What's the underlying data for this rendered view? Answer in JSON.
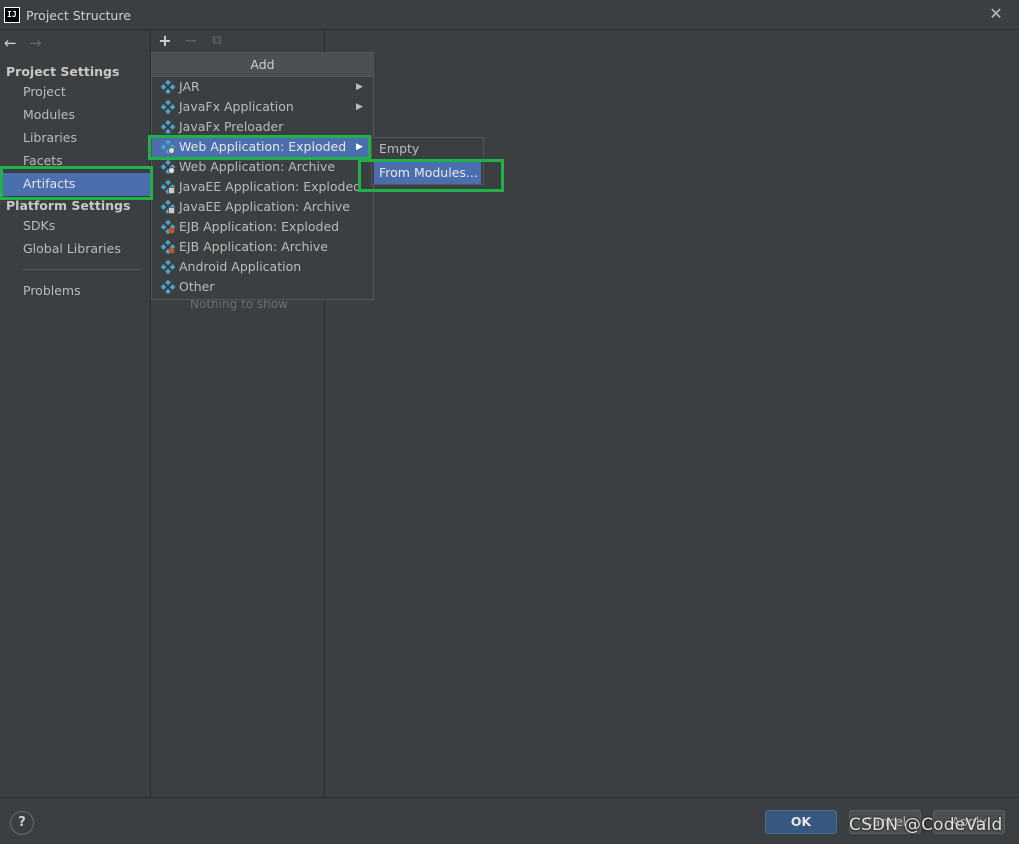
{
  "window": {
    "title": "Project Structure"
  },
  "sidebar": {
    "project_settings_header": "Project Settings",
    "project_items": [
      "Project",
      "Modules",
      "Libraries",
      "Facets",
      "Artifacts"
    ],
    "platform_settings_header": "Platform Settings",
    "platform_items": [
      "SDKs",
      "Global Libraries"
    ],
    "problems": "Problems",
    "selected": "Artifacts"
  },
  "artifacts": {
    "empty_text": "Nothing to show"
  },
  "add_menu": {
    "title": "Add",
    "items": [
      {
        "label": "JAR",
        "submenu": true
      },
      {
        "label": "JavaFx Application",
        "submenu": true
      },
      {
        "label": "JavaFx Preloader",
        "submenu": false
      },
      {
        "label": "Web Application: Exploded",
        "submenu": true
      },
      {
        "label": "Web Application: Archive",
        "submenu": false
      },
      {
        "label": "JavaEE Application: Exploded",
        "submenu": false
      },
      {
        "label": "JavaEE Application: Archive",
        "submenu": false
      },
      {
        "label": "EJB Application: Exploded",
        "submenu": false
      },
      {
        "label": "EJB Application: Archive",
        "submenu": false
      },
      {
        "label": "Android Application",
        "submenu": false
      },
      {
        "label": "Other",
        "submenu": false
      }
    ],
    "active_item": "Web Application: Exploded"
  },
  "submenu": {
    "items": [
      "Empty",
      "From Modules..."
    ],
    "active_item": "From Modules..."
  },
  "buttons": {
    "ok": "OK",
    "cancel": "Cancel",
    "apply": "Apply",
    "help": "?"
  },
  "watermark": "CSDN @CodeVald",
  "colors": {
    "selection": "#4b6eaf",
    "highlight_box": "#21b14b",
    "artifact_icon": "#4aa3c8"
  }
}
